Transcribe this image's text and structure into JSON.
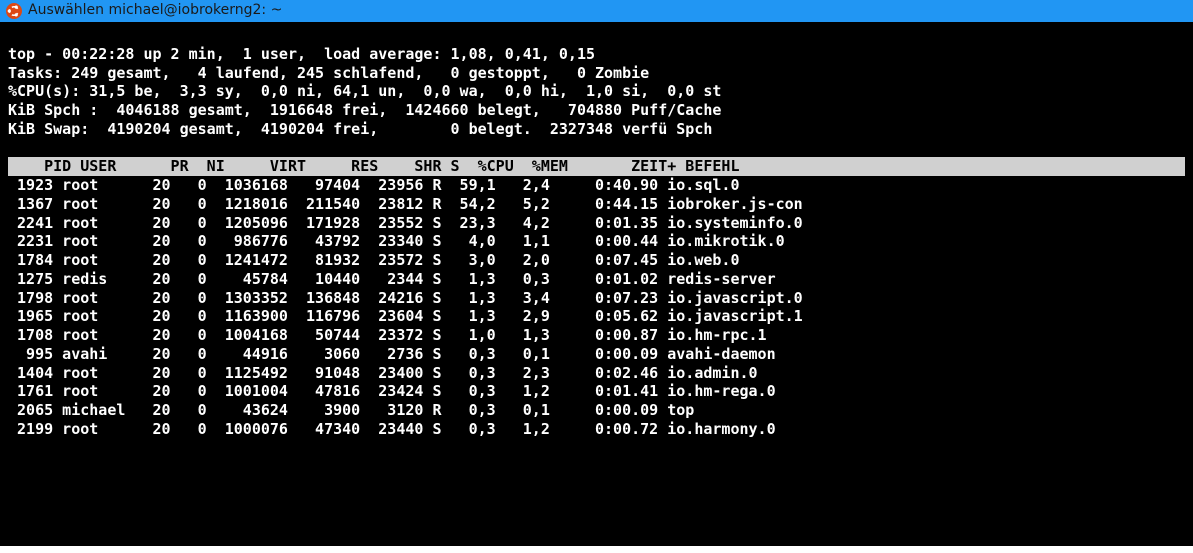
{
  "titlebar": {
    "text": "Auswählen michael@iobrokerng2: ~"
  },
  "summary": {
    "line1": "top - 00:22:28 up 2 min,  1 user,  load average: 1,08, 0,41, 0,15",
    "line2": "Tasks: 249 gesamt,   4 laufend, 245 schlafend,   0 gestoppt,   0 Zombie",
    "line3": "%CPU(s): 31,5 be,  3,3 sy,  0,0 ni, 64,1 un,  0,0 wa,  0,0 hi,  1,0 si,  0,0 st",
    "line4": "KiB Spch :  4046188 gesamt,  1916648 frei,  1424660 belegt,   704880 Puff/Cache",
    "line5": "KiB Swap:  4190204 gesamt,  4190204 frei,        0 belegt.  2327348 verfü Spch"
  },
  "columns": [
    "PID",
    "USER",
    "PR",
    "NI",
    "VIRT",
    "RES",
    "SHR",
    "S",
    "%CPU",
    "%MEM",
    "ZEIT+",
    "BEFEHL"
  ],
  "processes": [
    {
      "pid": "1923",
      "user": "root",
      "pr": "20",
      "ni": "0",
      "virt": "1036168",
      "res": "97404",
      "shr": "23956",
      "s": "R",
      "cpu": "59,1",
      "mem": "2,4",
      "time": "0:40.90",
      "cmd": "io.sql.0"
    },
    {
      "pid": "1367",
      "user": "root",
      "pr": "20",
      "ni": "0",
      "virt": "1218016",
      "res": "211540",
      "shr": "23812",
      "s": "R",
      "cpu": "54,2",
      "mem": "5,2",
      "time": "0:44.15",
      "cmd": "iobroker.js-con"
    },
    {
      "pid": "2241",
      "user": "root",
      "pr": "20",
      "ni": "0",
      "virt": "1205096",
      "res": "171928",
      "shr": "23552",
      "s": "S",
      "cpu": "23,3",
      "mem": "4,2",
      "time": "0:01.35",
      "cmd": "io.systeminfo.0"
    },
    {
      "pid": "2231",
      "user": "root",
      "pr": "20",
      "ni": "0",
      "virt": "986776",
      "res": "43792",
      "shr": "23340",
      "s": "S",
      "cpu": "4,0",
      "mem": "1,1",
      "time": "0:00.44",
      "cmd": "io.mikrotik.0"
    },
    {
      "pid": "1784",
      "user": "root",
      "pr": "20",
      "ni": "0",
      "virt": "1241472",
      "res": "81932",
      "shr": "23572",
      "s": "S",
      "cpu": "3,0",
      "mem": "2,0",
      "time": "0:07.45",
      "cmd": "io.web.0"
    },
    {
      "pid": "1275",
      "user": "redis",
      "pr": "20",
      "ni": "0",
      "virt": "45784",
      "res": "10440",
      "shr": "2344",
      "s": "S",
      "cpu": "1,3",
      "mem": "0,3",
      "time": "0:01.02",
      "cmd": "redis-server"
    },
    {
      "pid": "1798",
      "user": "root",
      "pr": "20",
      "ni": "0",
      "virt": "1303352",
      "res": "136848",
      "shr": "24216",
      "s": "S",
      "cpu": "1,3",
      "mem": "3,4",
      "time": "0:07.23",
      "cmd": "io.javascript.0"
    },
    {
      "pid": "1965",
      "user": "root",
      "pr": "20",
      "ni": "0",
      "virt": "1163900",
      "res": "116796",
      "shr": "23604",
      "s": "S",
      "cpu": "1,3",
      "mem": "2,9",
      "time": "0:05.62",
      "cmd": "io.javascript.1"
    },
    {
      "pid": "1708",
      "user": "root",
      "pr": "20",
      "ni": "0",
      "virt": "1004168",
      "res": "50744",
      "shr": "23372",
      "s": "S",
      "cpu": "1,0",
      "mem": "1,3",
      "time": "0:00.87",
      "cmd": "io.hm-rpc.1"
    },
    {
      "pid": "995",
      "user": "avahi",
      "pr": "20",
      "ni": "0",
      "virt": "44916",
      "res": "3060",
      "shr": "2736",
      "s": "S",
      "cpu": "0,3",
      "mem": "0,1",
      "time": "0:00.09",
      "cmd": "avahi-daemon"
    },
    {
      "pid": "1404",
      "user": "root",
      "pr": "20",
      "ni": "0",
      "virt": "1125492",
      "res": "91048",
      "shr": "23400",
      "s": "S",
      "cpu": "0,3",
      "mem": "2,3",
      "time": "0:02.46",
      "cmd": "io.admin.0"
    },
    {
      "pid": "1761",
      "user": "root",
      "pr": "20",
      "ni": "0",
      "virt": "1001004",
      "res": "47816",
      "shr": "23424",
      "s": "S",
      "cpu": "0,3",
      "mem": "1,2",
      "time": "0:01.41",
      "cmd": "io.hm-rega.0"
    },
    {
      "pid": "2065",
      "user": "michael",
      "pr": "20",
      "ni": "0",
      "virt": "43624",
      "res": "3900",
      "shr": "3120",
      "s": "R",
      "cpu": "0,3",
      "mem": "0,1",
      "time": "0:00.09",
      "cmd": "top"
    },
    {
      "pid": "2199",
      "user": "root",
      "pr": "20",
      "ni": "0",
      "virt": "1000076",
      "res": "47340",
      "shr": "23440",
      "s": "S",
      "cpu": "0,3",
      "mem": "1,2",
      "time": "0:00.72",
      "cmd": "io.harmony.0"
    }
  ]
}
